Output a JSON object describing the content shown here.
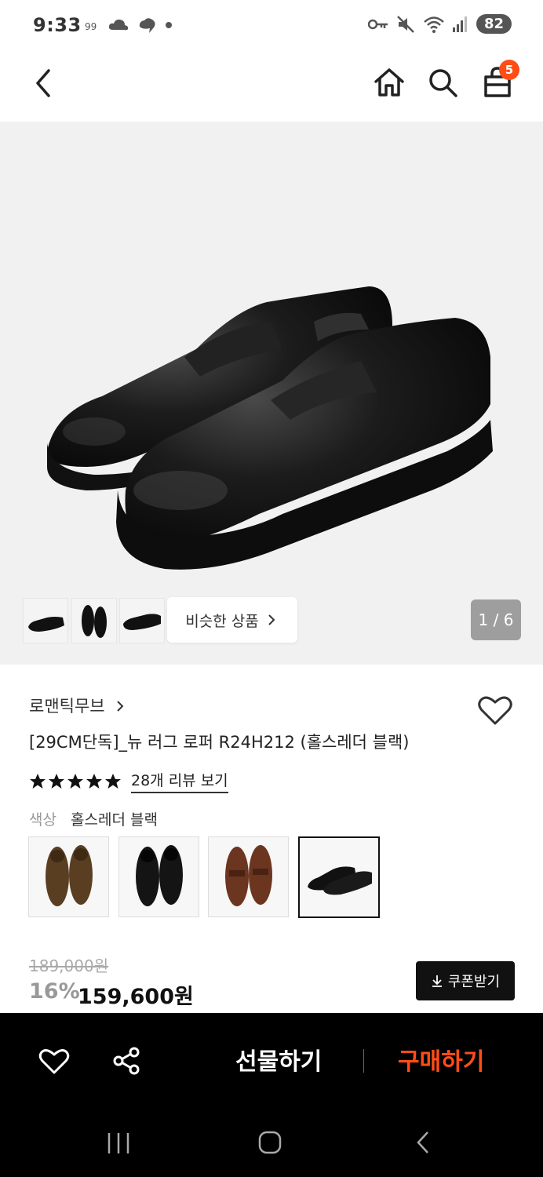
{
  "status_bar": {
    "time": "9:33",
    "battery": "82"
  },
  "header": {
    "cart_count": "5"
  },
  "gallery": {
    "similar_label": "비슷한 상품",
    "pager": "1 / 6"
  },
  "product": {
    "brand": "로맨틱무브",
    "title": "[29CM단독]_뉴 러그 로퍼 R24H212 (홀스레더 블랙)",
    "rating_stars": 5,
    "review_link": "28개 리뷰 보기",
    "color_label": "색상",
    "color_value": "홀스레더 블랙"
  },
  "price": {
    "original": "189,000원",
    "discount": "16%",
    "sale": "159,600원",
    "coupon_label": "쿠폰받기"
  },
  "action_bar": {
    "gift_label": "선물하기",
    "buy_label": "구매하기"
  },
  "colors": {
    "accent": "#ff4d16",
    "dark": "#111111"
  }
}
